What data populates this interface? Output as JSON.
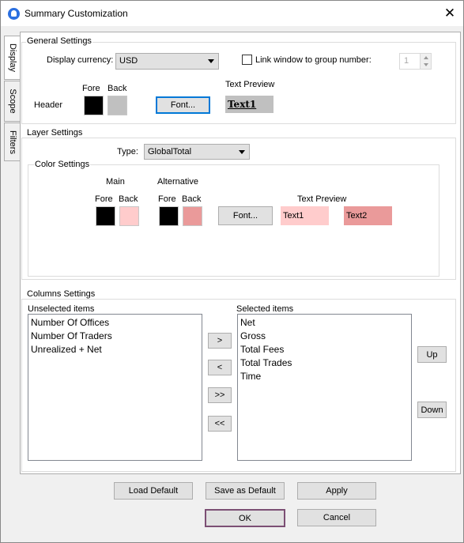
{
  "window": {
    "title": "Summary Customization",
    "close_glyph": "✕"
  },
  "tabs": [
    {
      "label": "Display"
    },
    {
      "label": "Scope"
    },
    {
      "label": "Filters"
    }
  ],
  "general": {
    "group_label": "General Settings",
    "currency_label": "Display currency:",
    "currency_value": "USD",
    "link_label": "Link window to group number:",
    "link_checked": false,
    "group_number": "1",
    "fore_label": "Fore",
    "back_label": "Back",
    "header_label": "Header",
    "fore_color": "#000000",
    "back_color": "#c0c0c0",
    "font_button": "Font...",
    "text_preview_label": "Text Preview",
    "text_preview_value": "Text1",
    "text_preview_bg": "#c0c0c0"
  },
  "layer": {
    "group_label": "Layer Settings",
    "type_label": "Type:",
    "type_value": "GlobalTotal",
    "color_group_label": "Color Settings",
    "main_label": "Main",
    "alt_label": "Alternative",
    "fore_label": "Fore",
    "back_label": "Back",
    "alt_fore_label": "Fore",
    "alt_back_label": "Back",
    "main_fore_color": "#000000",
    "main_back_color": "#ffcccc",
    "alt_fore_color": "#000000",
    "alt_back_color": "#ea9a9a",
    "font_button": "Font...",
    "text_preview_label": "Text Preview",
    "preview1": "Text1",
    "preview2": "Text2"
  },
  "columns": {
    "group_label": "Columns Settings",
    "unselected_label": "Unselected items",
    "selected_label": "Selected items",
    "unselected": [
      "Number Of Offices",
      "Number Of Traders",
      "Unrealized + Net"
    ],
    "selected": [
      "Net",
      "Gross",
      "Total Fees",
      "Total Trades",
      "Time"
    ],
    "move_right": ">",
    "move_left": "<",
    "move_all_right": ">>",
    "move_all_left": "<<",
    "up": "Up",
    "down": "Down"
  },
  "footer": {
    "load_default": "Load Default",
    "save_default": "Save as Default",
    "apply": "Apply",
    "ok": "OK",
    "cancel": "Cancel"
  }
}
